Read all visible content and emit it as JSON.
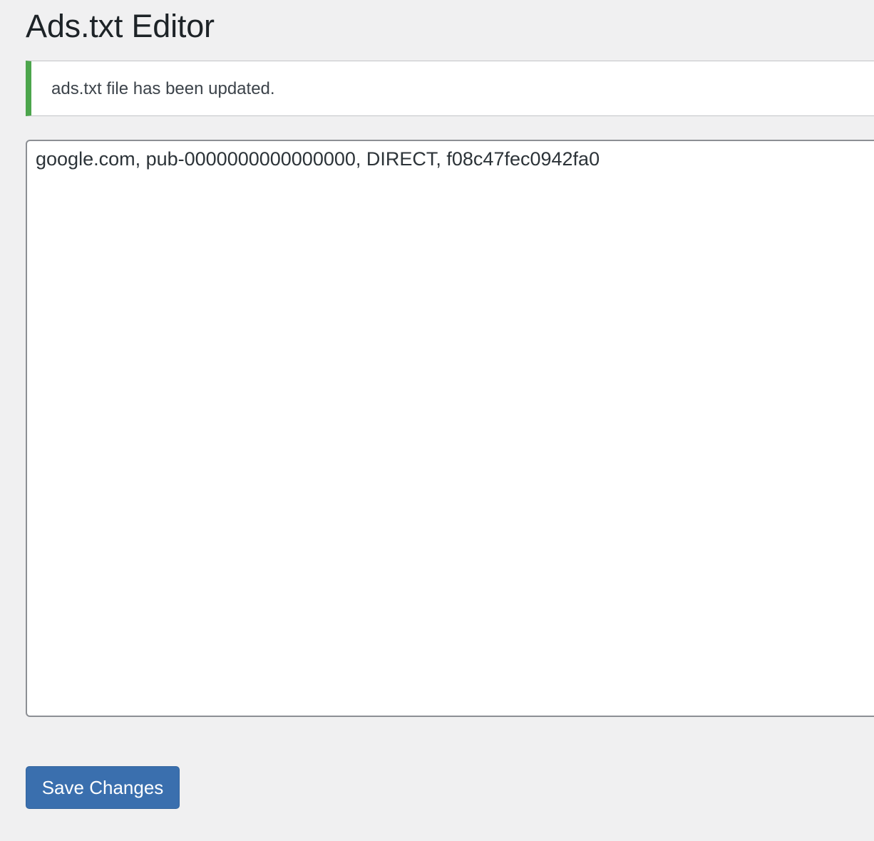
{
  "page": {
    "title": "Ads.txt Editor"
  },
  "notice": {
    "message": "ads.txt file has been updated.",
    "type": "success",
    "accent_color": "#4ca54c"
  },
  "editor": {
    "value": "google.com, pub-0000000000000000, DIRECT, f08c47fec0942fa0"
  },
  "actions": {
    "save_label": "Save Changes",
    "save_color": "#3a6fae"
  }
}
